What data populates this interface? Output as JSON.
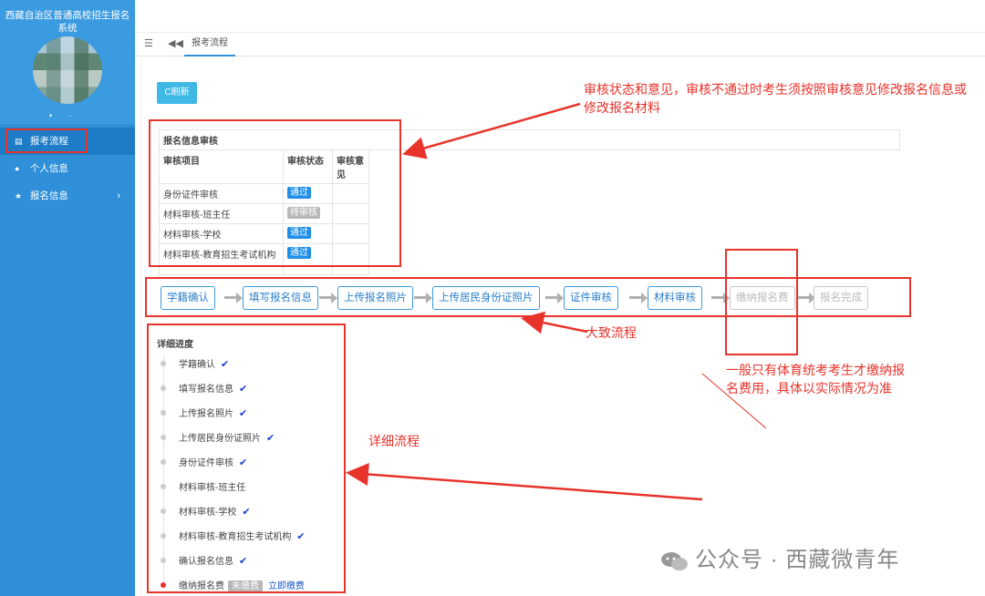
{
  "sidebar": {
    "system_title": "西藏自治区普通高校招生报名系统",
    "user_dots": "• ·",
    "items": [
      {
        "label": "报考流程",
        "icon": "list-icon"
      },
      {
        "label": "个人信息",
        "icon": "user-icon"
      },
      {
        "label": "报名信息",
        "icon": "star-icon"
      }
    ]
  },
  "tabbar": {
    "tab_label": "报考流程"
  },
  "main": {
    "refresh_label": "C刷新",
    "review": {
      "caption": "报名信息审核",
      "headers": [
        "审核项目",
        "审核状态",
        "审核意见"
      ],
      "rows": [
        {
          "item": "身份证件审核",
          "status": "通过",
          "opinion": ""
        },
        {
          "item": "材料审核-班主任",
          "status": "待审核",
          "opinion": ""
        },
        {
          "item": "材料审核-学校",
          "status": "通过",
          "opinion": ""
        },
        {
          "item": "材料审核-教育招生考试机构",
          "status": "通过",
          "opinion": ""
        }
      ]
    },
    "steps": [
      "学籍确认",
      "填写报名信息",
      "上传报名照片",
      "上传居民身份证照片",
      "证件审核",
      "材料审核",
      "缴纳报名费",
      "报名完成"
    ],
    "detail": {
      "title": "详细进度",
      "items": [
        {
          "label": "学籍确认",
          "done": "✔"
        },
        {
          "label": "填写报名信息",
          "done": "✔"
        },
        {
          "label": "上传报名照片",
          "done": "✔"
        },
        {
          "label": "上传居民身份证照片",
          "done": "✔"
        },
        {
          "label": "身份证件审核",
          "done": "✔"
        },
        {
          "label": "材料审核-班主任",
          "done": ""
        },
        {
          "label": "材料审核-学校",
          "done": "✔"
        },
        {
          "label": "材料审核-教育招生考试机构",
          "done": "✔"
        },
        {
          "label": "确认报名信息",
          "done": "✔"
        },
        {
          "label": "缴纳报名费",
          "done": ""
        }
      ],
      "fee_status": "未缴费",
      "pay_link": "立即缴费"
    }
  },
  "annotations": {
    "review_note": "审核状态和意见，审核不通过时考生须按照审核意见修改报名信息或修改报名材料",
    "flow_note": "大致流程",
    "fee_note": "一般只有体育统考考生才缴纳报名费用，具体以实际情况为准",
    "detail_note": "详细流程",
    "color": "#e8332b"
  },
  "watermark": "公众号 · 西藏微青年"
}
